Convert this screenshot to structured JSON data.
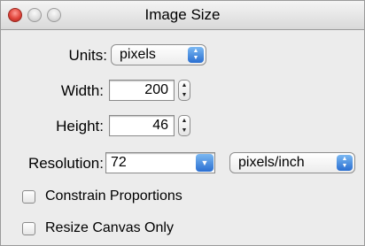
{
  "window": {
    "title": "Image Size"
  },
  "units": {
    "label": "Units:",
    "value": "pixels"
  },
  "width": {
    "label": "Width:",
    "value": "200"
  },
  "height": {
    "label": "Height:",
    "value": "46"
  },
  "resolution": {
    "label": "Resolution:",
    "value": "72",
    "unit": "pixels/inch"
  },
  "options": {
    "constrain_label": "Constrain Proportions",
    "constrain_checked": false,
    "resize_canvas_label": "Resize Canvas Only",
    "resize_canvas_checked": false
  },
  "icons": {
    "close": "close-icon",
    "minimize": "minimize-icon",
    "zoom": "zoom-icon",
    "popup_arrows": "up-down-arrows-icon",
    "stepper": "stepper-arrows-icon",
    "combo": "chevron-down-icon"
  },
  "colors": {
    "accent": "#2a6fd1",
    "close_button": "#e0443b"
  }
}
